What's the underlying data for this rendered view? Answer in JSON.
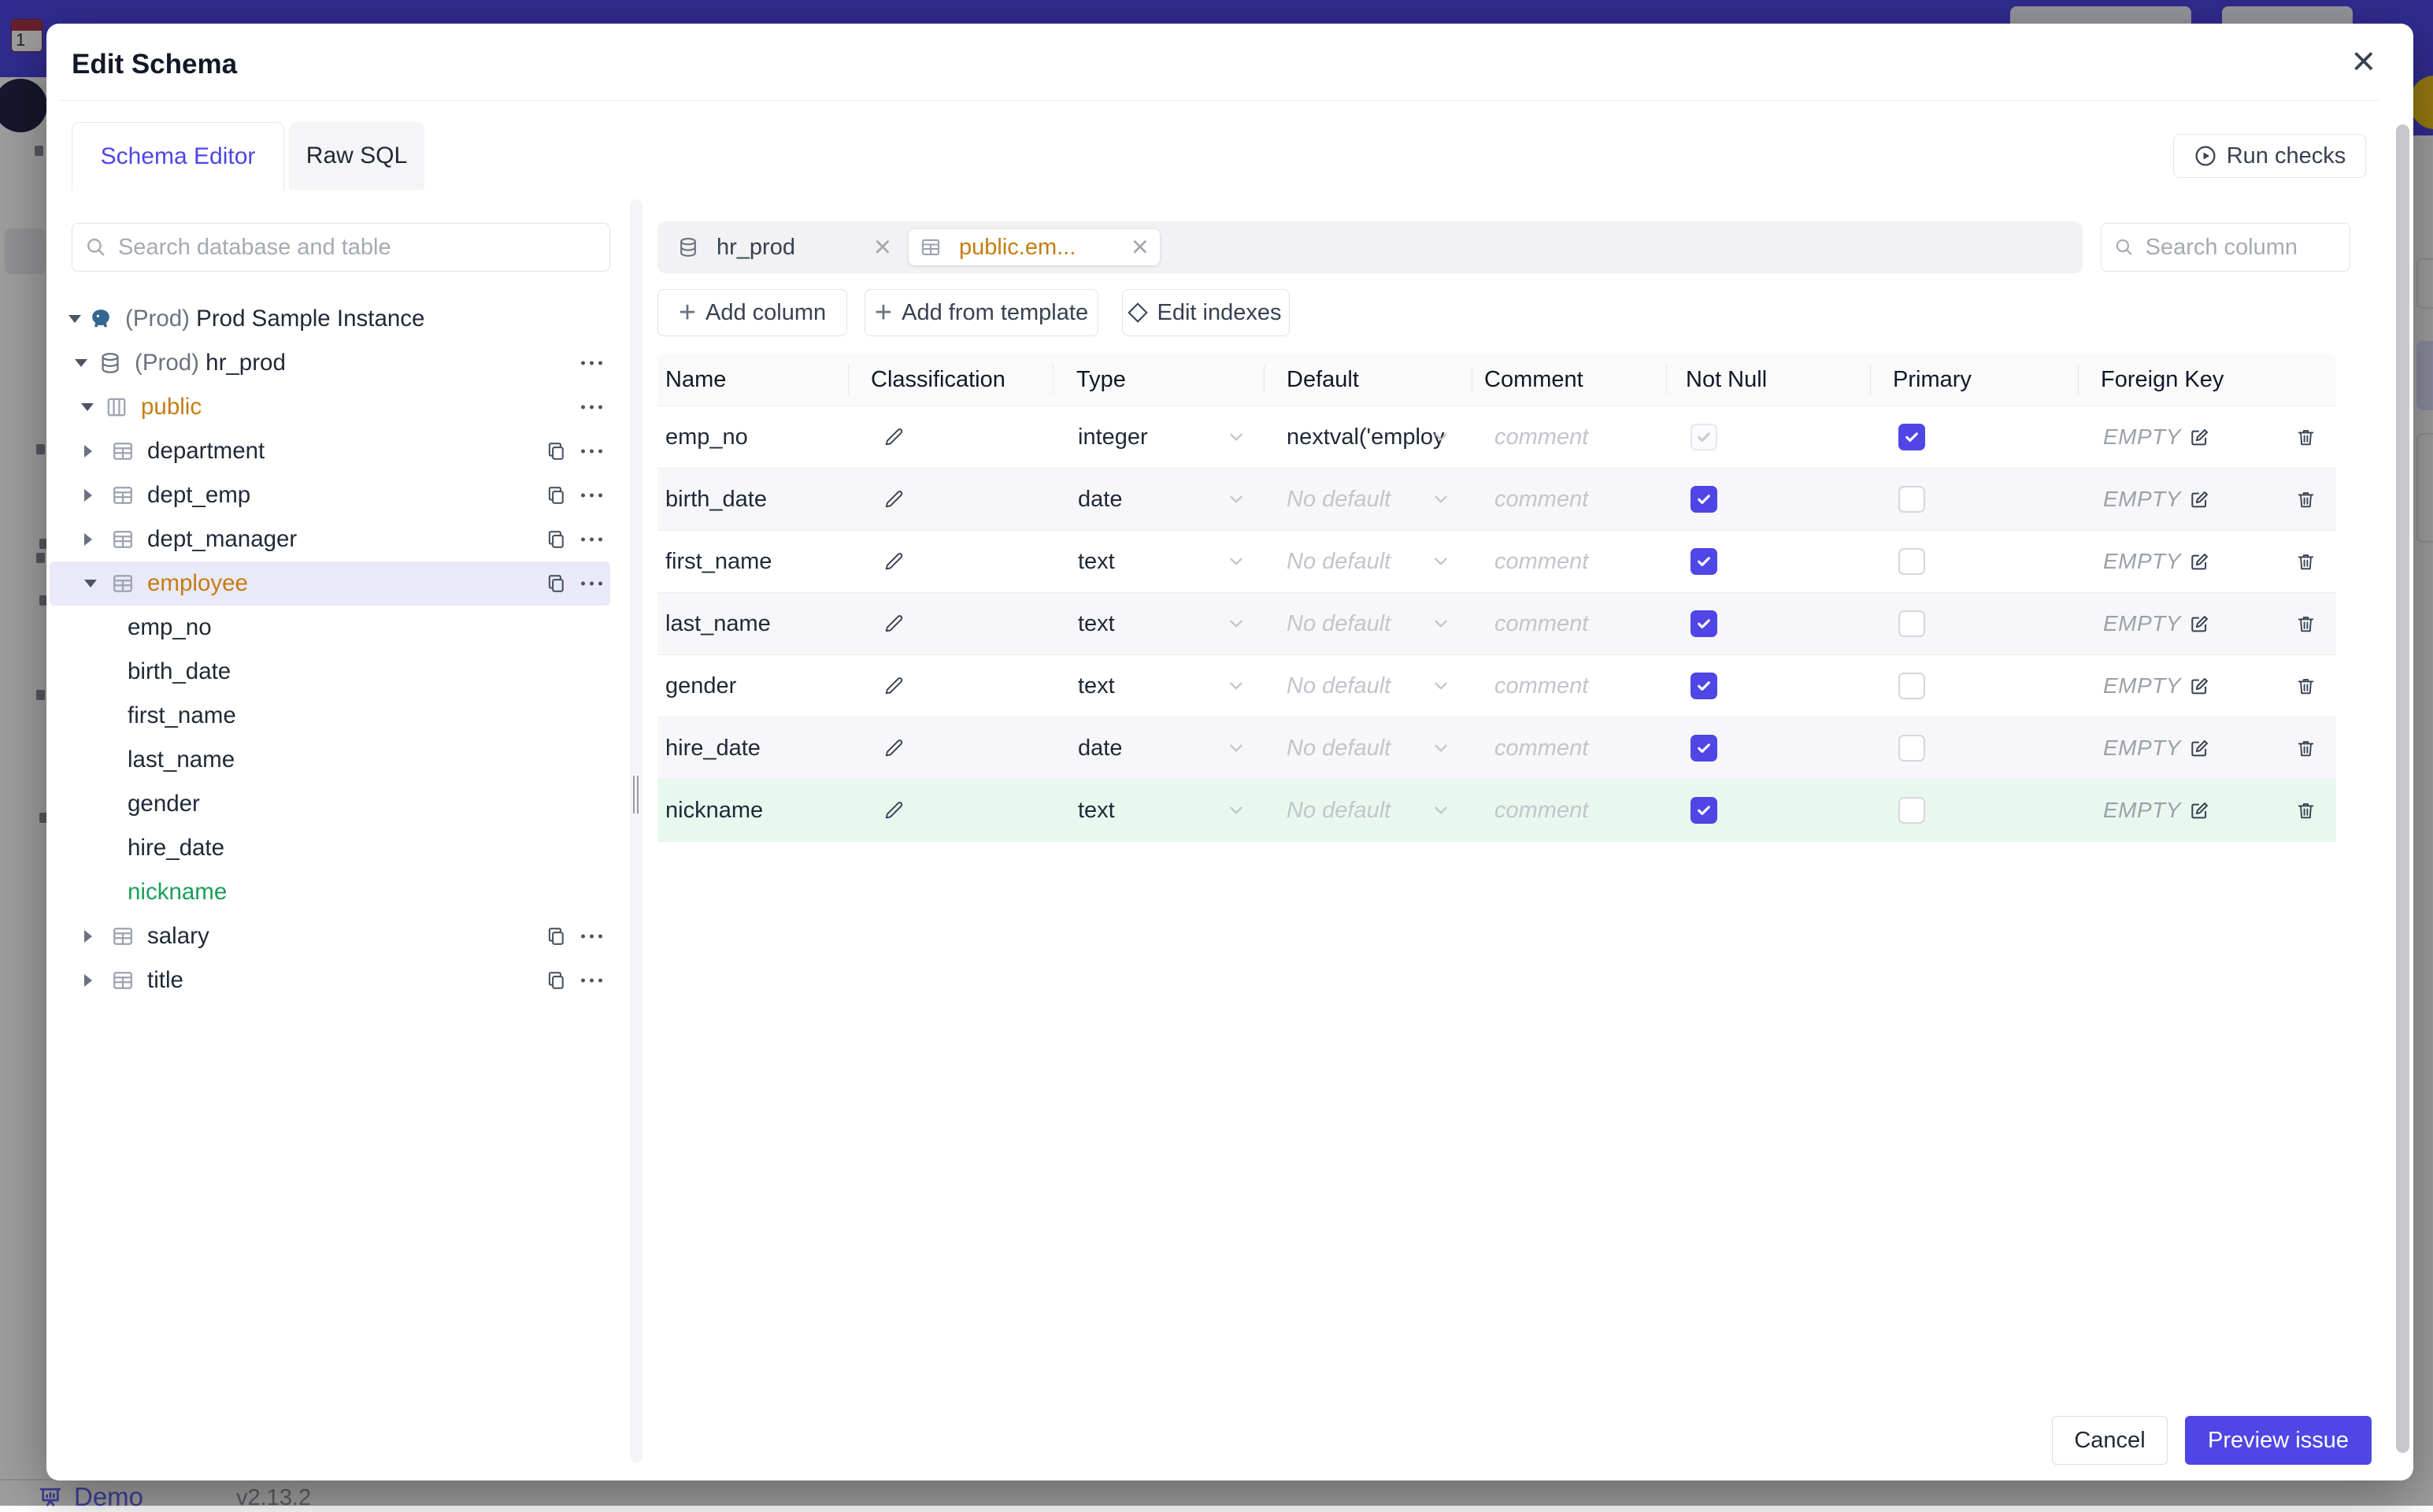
{
  "backdrop": {
    "demo_label": "Demo",
    "version": "v2.13.2"
  },
  "modal": {
    "title": "Edit Schema",
    "close_glyph": "×",
    "tabs": [
      {
        "label": "Schema Editor",
        "active": true
      },
      {
        "label": "Raw SQL",
        "active": false
      }
    ],
    "run_checks_label": "Run checks",
    "sidebar": {
      "search_placeholder": "Search database and table",
      "tree": [
        {
          "level": 1,
          "arrow": "down",
          "icon": "postgres",
          "prefix": "(Prod)",
          "label": "Prod Sample Instance"
        },
        {
          "level": 2,
          "arrow": "down",
          "icon": "database",
          "prefix": "(Prod)",
          "label": "hr_prod",
          "more": true
        },
        {
          "level": 3,
          "arrow": "down",
          "icon": "schema",
          "label": "public",
          "color": "amber",
          "more": true
        },
        {
          "level": 4,
          "arrow": "right",
          "icon": "table",
          "label": "department",
          "copy": true,
          "more": true
        },
        {
          "level": 4,
          "arrow": "right",
          "icon": "table",
          "label": "dept_emp",
          "copy": true,
          "more": true
        },
        {
          "level": 4,
          "arrow": "right",
          "icon": "table",
          "label": "dept_manager",
          "copy": true,
          "more": true
        },
        {
          "level": 4,
          "arrow": "down",
          "icon": "table",
          "label": "employee",
          "color": "amber",
          "selected": true,
          "copy": true,
          "more": true
        },
        {
          "level": 5,
          "label": "emp_no"
        },
        {
          "level": 5,
          "label": "birth_date"
        },
        {
          "level": 5,
          "label": "first_name"
        },
        {
          "level": 5,
          "label": "last_name"
        },
        {
          "level": 5,
          "label": "gender"
        },
        {
          "level": 5,
          "label": "hire_date"
        },
        {
          "level": 5,
          "label": "nickname",
          "color": "green"
        },
        {
          "level": 4,
          "arrow": "right",
          "icon": "table",
          "label": "salary",
          "copy": true,
          "more": true
        },
        {
          "level": 4,
          "arrow": "right",
          "icon": "table",
          "label": "title",
          "copy": true,
          "more": true
        }
      ]
    },
    "editor": {
      "chips": [
        {
          "label": "hr_prod",
          "icon": "database",
          "active": false
        },
        {
          "label": "public.em...",
          "icon": "table",
          "active": true
        }
      ],
      "column_search_placeholder": "Search column",
      "toolbar": {
        "add_column": "Add column",
        "add_from_template": "Add from template",
        "edit_indexes": "Edit indexes"
      },
      "table": {
        "headers": [
          "Name",
          "Classification",
          "Type",
          "Default",
          "Comment",
          "Not Null",
          "Primary",
          "Foreign Key"
        ],
        "comment_placeholder": "comment",
        "fk_placeholder": "EMPTY",
        "rows": [
          {
            "name": "emp_no",
            "type": "integer",
            "default": "nextval('employ",
            "default_muted": false,
            "not_null": true,
            "not_null_disabled": true,
            "primary": true,
            "highlight": null
          },
          {
            "name": "birth_date",
            "type": "date",
            "default": "No default",
            "default_muted": true,
            "not_null": true,
            "not_null_disabled": false,
            "primary": false,
            "highlight": null
          },
          {
            "name": "first_name",
            "type": "text",
            "default": "No default",
            "default_muted": true,
            "not_null": true,
            "not_null_disabled": false,
            "primary": false,
            "highlight": null
          },
          {
            "name": "last_name",
            "type": "text",
            "default": "No default",
            "default_muted": true,
            "not_null": true,
            "not_null_disabled": false,
            "primary": false,
            "highlight": null
          },
          {
            "name": "gender",
            "type": "text",
            "default": "No default",
            "default_muted": true,
            "not_null": true,
            "not_null_disabled": false,
            "primary": false,
            "highlight": null
          },
          {
            "name": "hire_date",
            "type": "date",
            "default": "No default",
            "default_muted": true,
            "not_null": true,
            "not_null_disabled": false,
            "primary": false,
            "highlight": null
          },
          {
            "name": "nickname",
            "type": "text",
            "default": "No default",
            "default_muted": true,
            "not_null": true,
            "not_null_disabled": false,
            "primary": false,
            "highlight": "green"
          }
        ]
      }
    },
    "footer": {
      "cancel": "Cancel",
      "primary": "Preview issue"
    }
  },
  "colors": {
    "accent": "#4f46e5",
    "amber": "#c47d12",
    "green": "#18a058",
    "green_row_bg": "#e9f8ef",
    "selected_row_bg": "#e9e9f8",
    "topbar": "#4f46e5"
  }
}
